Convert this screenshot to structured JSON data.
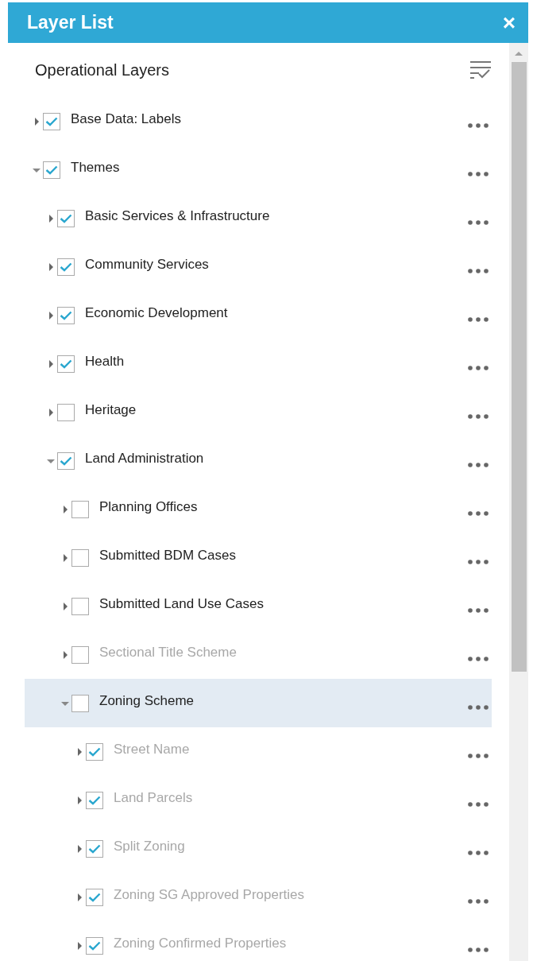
{
  "panel": {
    "title": "Layer List",
    "close": "×"
  },
  "heading": "Operational Layers",
  "layers": [
    {
      "label": "Base Data: Labels",
      "checked": true,
      "expanded": false,
      "disabled": false,
      "selected": false
    },
    {
      "label": "Themes",
      "checked": true,
      "expanded": true,
      "disabled": false,
      "selected": false,
      "children": [
        {
          "label": "Basic Services & Infrastructure",
          "checked": true,
          "expanded": false,
          "disabled": false,
          "selected": false
        },
        {
          "label": "Community Services",
          "checked": true,
          "expanded": false,
          "disabled": false,
          "selected": false
        },
        {
          "label": "Economic Development",
          "checked": true,
          "expanded": false,
          "disabled": false,
          "selected": false
        },
        {
          "label": "Health",
          "checked": true,
          "expanded": false,
          "disabled": false,
          "selected": false
        },
        {
          "label": "Heritage",
          "checked": false,
          "expanded": false,
          "disabled": false,
          "selected": false
        },
        {
          "label": "Land Administration",
          "checked": true,
          "expanded": true,
          "disabled": false,
          "selected": false,
          "children": [
            {
              "label": "Planning Offices",
              "checked": false,
              "expanded": false,
              "disabled": false,
              "selected": false
            },
            {
              "label": "Submitted BDM Cases",
              "checked": false,
              "expanded": false,
              "disabled": false,
              "selected": false
            },
            {
              "label": "Submitted Land Use Cases",
              "checked": false,
              "expanded": false,
              "disabled": false,
              "selected": false
            },
            {
              "label": "Sectional Title Scheme",
              "checked": false,
              "expanded": false,
              "disabled": true,
              "selected": false
            },
            {
              "label": "Zoning Scheme",
              "checked": false,
              "expanded": true,
              "disabled": false,
              "selected": true,
              "children": [
                {
                  "label": "Street Name",
                  "checked": true,
                  "expanded": false,
                  "disabled": true,
                  "selected": false
                },
                {
                  "label": "Land Parcels",
                  "checked": true,
                  "expanded": false,
                  "disabled": true,
                  "selected": false
                },
                {
                  "label": "Split Zoning",
                  "checked": true,
                  "expanded": false,
                  "disabled": true,
                  "selected": false
                },
                {
                  "label": "Zoning SG Approved Properties",
                  "checked": true,
                  "expanded": false,
                  "disabled": true,
                  "selected": false
                },
                {
                  "label": "Zoning Confirmed Properties",
                  "checked": true,
                  "expanded": false,
                  "disabled": true,
                  "selected": false
                }
              ]
            }
          ]
        }
      ]
    }
  ]
}
